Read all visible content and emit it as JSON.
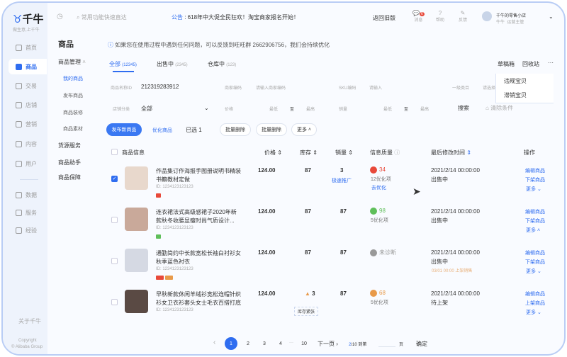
{
  "brand": {
    "name": "千牛",
    "slogan": "做生意,上千牛"
  },
  "topbar": {
    "search_placeholder": "常用功能快速直达",
    "notice_label": "公告",
    "notice_text": "618年中大促全民狂欢！淘宝商家报名开始！",
    "old_version": "返回旧版",
    "icons": [
      {
        "label": "消息",
        "badge": "6"
      },
      {
        "label": "帮助"
      },
      {
        "label": "反馈"
      }
    ],
    "shop_name": "千牛的零售小店",
    "user": "牛牛",
    "role": "运营主管"
  },
  "sidebar": {
    "items": [
      "首页",
      "商品",
      "交易",
      "店铺",
      "营销",
      "内容",
      "用户",
      "数据",
      "服务",
      "经验"
    ],
    "about": "关于千牛",
    "copyright1": "Copyright",
    "copyright2": "© Alibaba Group"
  },
  "subnav": {
    "title": "商品",
    "group": "商品管理",
    "items": [
      "我的商品",
      "发布商品",
      "商品装修",
      "商品素材"
    ],
    "others": [
      "货源服务",
      "商品助手",
      "商品保障"
    ]
  },
  "notice": "如果您在使用过程中遇到任何问题，可以反馈到旺旺群 2662906756，我们会持续优化",
  "tabs": [
    {
      "label": "全部",
      "count": "(12345)"
    },
    {
      "label": "出售中",
      "count": "(2345)"
    },
    {
      "label": "仓库中",
      "count": "(123)"
    }
  ],
  "tab_actions": {
    "draft": "草稿箱",
    "recycle": "回收站",
    "more": "···"
  },
  "dropdown": [
    "违规宝贝",
    "滞销宝贝"
  ],
  "filters": {
    "name_label": "商品名称ID",
    "name_value": "212319283912",
    "merchant_label": "商家编码",
    "merchant_ph": "请输入商家编码",
    "sku_label": "SKU编码",
    "sku_ph": "请输入",
    "cat_label": "一级类目",
    "cat_ph": "请选择",
    "shopcat_label": "店铺分类",
    "shopcat_value": "全部",
    "price_label": "价格",
    "low": "最低",
    "to": "至",
    "high": "最高",
    "sales_label": "销量",
    "search": "搜索",
    "clear": "清除条件"
  },
  "actions": {
    "publish": "发布新商品",
    "optimize": "优化商品",
    "selected": "已选 1",
    "batch_delete1": "批量删除",
    "batch_delete2": "批量删除",
    "more": "更多"
  },
  "table": {
    "headers": [
      "商品信息",
      "价格",
      "库存",
      "销量",
      "信息质量",
      "最后修改时间",
      "操作"
    ],
    "rows": [
      {
        "title1": "作品集订作海报手图册说明书精装",
        "title2": "书籍教材定做",
        "id": "ID: 1234123123123",
        "price": "124.00",
        "stock": "87",
        "sales": "3",
        "sales_link": "极速推广",
        "score": "34",
        "score_color": "#e8493a",
        "opt": "12优化项",
        "opt_link": "去优化",
        "time": "2021/2/14 00:00:00",
        "status": "出售中",
        "ops": [
          "编辑商品",
          "下架商品",
          "更多"
        ],
        "checked": true
      },
      {
        "title1": "连衣裙法式高级感裙子2020年新",
        "title2": "款秋冬收腰显瘦时尚气质设计...",
        "id": "ID: 1234123123123",
        "price": "124.00",
        "stock": "87",
        "sales": "87",
        "score": "98",
        "score_color": "#5fbf5a",
        "opt": "5优化项",
        "time": "2021/2/14 00:00:00",
        "status": "出售中",
        "ops": [
          "编辑商品",
          "下架商品",
          "更多"
        ]
      },
      {
        "title1": "通勤简约中长款宽松长袖白衬衫女",
        "title2": "秋季蓝色衬衣",
        "id": "ID: 1234123123123",
        "price": "124.00",
        "stock": "87",
        "sales": "87",
        "score": "未诊断",
        "score_color": "#999999",
        "time": "2021/2/14 00:00:00",
        "status": "出售中",
        "scheduled": "03/01 00:00 上架销售",
        "ops": [
          "编辑商品",
          "下架商品",
          "更多"
        ]
      },
      {
        "title1": "早秋新款休闲羊绒衫宽松连帽针织",
        "title2": "衫女卫衣衫套头女士毛衣百搭打底",
        "id": "ID: 1234123123123",
        "price": "124.00",
        "stock": "3",
        "stock_warn": "库存紧张",
        "sales": "87",
        "score": "68",
        "score_color": "#e89a4a",
        "opt": "5优化项",
        "time": "2021/2/14 00:00:00",
        "status": "待上架",
        "ops": [
          "编辑商品",
          "上架商品",
          "更多"
        ]
      }
    ]
  },
  "pagination": {
    "pages": [
      "1",
      "2",
      "3",
      "4",
      "10"
    ],
    "ellipsis": "···",
    "next": "下一页",
    "current": "2",
    "total": "/10",
    "goto": "到第",
    "page": "页",
    "confirm": "确定"
  }
}
